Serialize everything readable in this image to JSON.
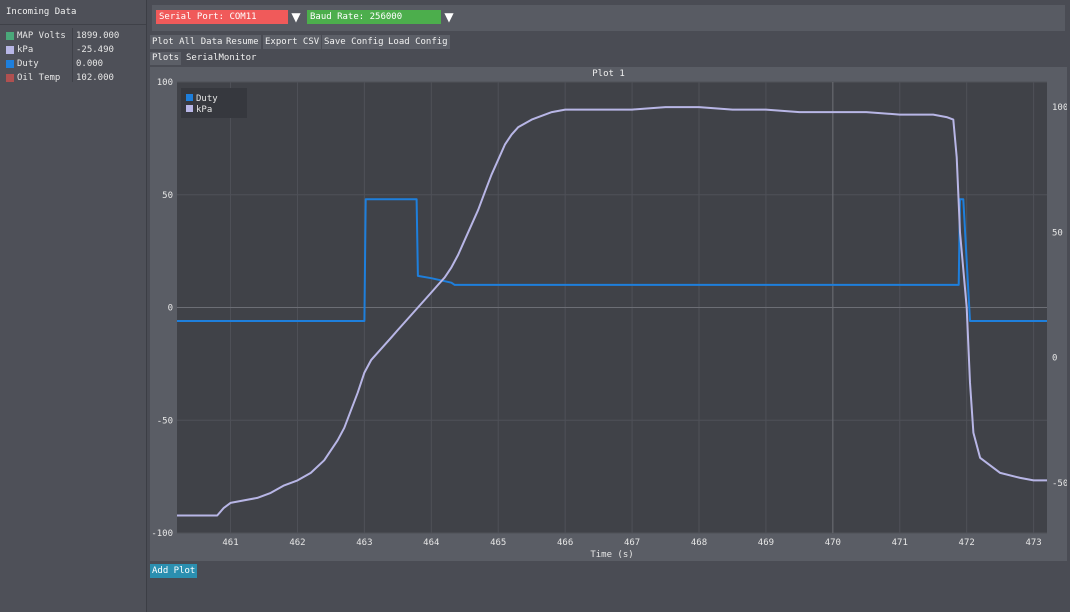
{
  "sidebar": {
    "title": "Incoming Data",
    "rows": [
      {
        "name": "MAP Volts",
        "value": "1899.000",
        "color": "#4aa87a"
      },
      {
        "name": "kPa",
        "value": "-25.490",
        "color": "#b8b6e6"
      },
      {
        "name": "Duty",
        "value": "0.000",
        "color": "#1e7fdc"
      },
      {
        "name": "Oil Temp",
        "value": "102.000",
        "color": "#b05050"
      }
    ]
  },
  "toolbar": {
    "serial_port": "Serial Port: COM11",
    "baud_rate": "Baud Rate: 256000",
    "serial_color": "#f05a5a",
    "baud_color": "#4cae4c",
    "dropdown_glyph": "▼"
  },
  "buttons": {
    "plot_all": "Plot All Data",
    "resume": "Resume",
    "export_csv": "Export CSV",
    "save_config": "Save Config",
    "load_config": "Load Config"
  },
  "tabs": {
    "plots": "Plots",
    "serial_monitor": "SerialMonitor"
  },
  "plot": {
    "title": "Plot 1"
  },
  "add_plot": "Add Plot",
  "chart_data": {
    "type": "line",
    "title": "Plot 1",
    "xlabel": "Time (s)",
    "xlim": [
      460.2,
      473.2
    ],
    "x_ticks": [
      461,
      462,
      463,
      464,
      465,
      466,
      467,
      468,
      469,
      470,
      471,
      472,
      473
    ],
    "y_left": {
      "lim": [
        -100,
        100
      ],
      "ticks": [
        -100,
        -50,
        0,
        50,
        100
      ]
    },
    "y_right": {
      "lim": [
        -70,
        110
      ],
      "ticks": [
        -50,
        0,
        50,
        100
      ]
    },
    "grid": true,
    "legend_position": "top-left",
    "series": [
      {
        "name": "Duty",
        "color": "#1e7fdc",
        "axis": "left",
        "x": [
          460.2,
          463.0,
          463.02,
          463.78,
          463.8,
          464.0,
          464.3,
          464.35,
          471.88,
          471.9,
          471.95,
          472.05,
          473.2
        ],
        "y": [
          -6,
          -6,
          48,
          48,
          14,
          13,
          11,
          10,
          10,
          48,
          48,
          -6,
          -6
        ]
      },
      {
        "name": "kPa",
        "color": "#b8b6e6",
        "axis": "right",
        "x": [
          460.2,
          460.5,
          460.8,
          460.9,
          461.0,
          461.2,
          461.4,
          461.6,
          461.8,
          462.0,
          462.2,
          462.4,
          462.5,
          462.6,
          462.7,
          462.8,
          462.9,
          463.0,
          463.1,
          463.2,
          463.3,
          463.4,
          463.5,
          463.6,
          463.7,
          463.8,
          463.9,
          464.0,
          464.1,
          464.2,
          464.3,
          464.4,
          464.5,
          464.6,
          464.7,
          464.8,
          464.9,
          465.0,
          465.1,
          465.2,
          465.3,
          465.5,
          465.8,
          466.0,
          466.5,
          467.0,
          467.5,
          468.0,
          468.5,
          469.0,
          469.5,
          470.0,
          470.5,
          471.0,
          471.5,
          471.7,
          471.8,
          471.85,
          471.9,
          472.0,
          472.05,
          472.1,
          472.2,
          472.5,
          472.8,
          473.0,
          473.2
        ],
        "y": [
          -63,
          -63,
          -63,
          -60,
          -58,
          -57,
          -56,
          -54,
          -51,
          -49,
          -46,
          -41,
          -37,
          -33,
          -28,
          -21,
          -14,
          -6,
          -1,
          2,
          5,
          8,
          11,
          14,
          17,
          20,
          23,
          26,
          29,
          32,
          36,
          41,
          47,
          53,
          59,
          66,
          73,
          79,
          85,
          89,
          92,
          95,
          98,
          99,
          99,
          99,
          100,
          100,
          99,
          99,
          98,
          98,
          98,
          97,
          97,
          96,
          95,
          80,
          50,
          20,
          -10,
          -30,
          -40,
          -46,
          -48,
          -49,
          -49
        ]
      }
    ]
  }
}
